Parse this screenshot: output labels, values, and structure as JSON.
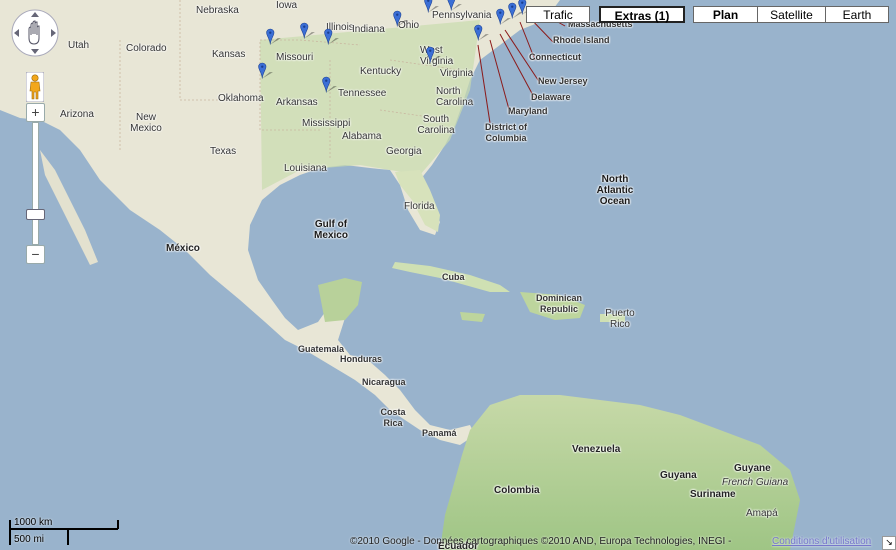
{
  "controls": {
    "maptypes": [
      {
        "label": "Trafic"
      },
      {
        "label": "Extras (1)"
      },
      {
        "label": "Plan"
      },
      {
        "label": "Satellite"
      },
      {
        "label": "Earth"
      }
    ],
    "zoom_in": "+",
    "zoom_out": "−",
    "pegman_icon": "pegman-icon",
    "pan_icon": "hand-pan-icon"
  },
  "scale": {
    "metric": "1000 km",
    "imperial": "500 mi"
  },
  "copyright": "©2010 Google - Données cartographiques ©2010 AND, Europa Technologies, INEGI -",
  "terms": "Conditions d'utilisation",
  "labels": {
    "states": [
      "Nebraska",
      "Iowa",
      "Illinois",
      "Indiana",
      "Ohio",
      "Pennsylvania",
      "Utah",
      "Colorado",
      "Kansas",
      "Missouri",
      "Kentucky",
      "West Virginia",
      "Virginia",
      "Oklahoma",
      "Tennessee",
      "North Carolina",
      "Arkansas",
      "Arizona",
      "New Mexico",
      "Mississippi",
      "Alabama",
      "South Carolina",
      "Georgia",
      "Texas",
      "Louisiana",
      "Florida"
    ],
    "callouts": [
      "Massachusetts",
      "Rhode Island",
      "Connecticut",
      "New Jersey",
      "Delaware",
      "Maryland",
      "District of Columbia"
    ],
    "water": [
      "North Atlantic Ocean",
      "Gulf of Mexico"
    ],
    "countries": [
      "México",
      "Cuba",
      "Dominican Republic",
      "Puerto Rico",
      "Guatemala",
      "Honduras",
      "Nicaragua",
      "Costa Rica",
      "Panamá",
      "Venezuela",
      "Guyana",
      "Guyane",
      "French Guiana",
      "Suriname",
      "Colombia",
      "Amapá",
      "Ecuador"
    ]
  },
  "markers": {
    "count": 13,
    "icon": "map-pin-icon",
    "color": "#3b6fd6"
  },
  "colors": {
    "water": "#99b3cc",
    "land": "#e8e6d6",
    "forest": "#b8d19a"
  }
}
